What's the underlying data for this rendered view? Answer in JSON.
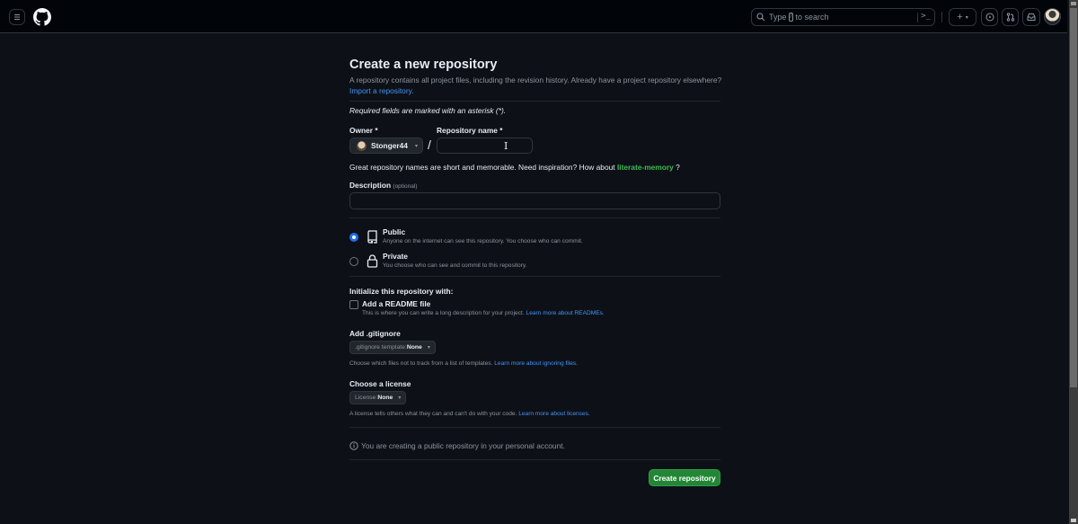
{
  "header": {
    "search_placeholder_pre": "Type",
    "search_key": "/",
    "search_placeholder_post": "to search",
    "command_palette_glyph": ">_",
    "create_new_glyph": "+"
  },
  "page": {
    "title": "Create a new repository",
    "subtitle": "A repository contains all project files, including the revision history. Already have a project repository elsewhere?",
    "import_link": "Import a repository.",
    "required_note": "Required fields are marked with an asterisk (*).",
    "owner_label": "Owner *",
    "owner_value": "Stonger44",
    "separator": "/",
    "repo_name_label": "Repository name *",
    "repo_name_value": "",
    "name_hint_pre": "Great repository names are short and memorable. Need inspiration? How about",
    "name_suggestion": "literate-memory",
    "name_hint_post": "?",
    "description_label": "Description",
    "description_optional": "(optional)",
    "description_value": "",
    "visibility": [
      {
        "title": "Public",
        "desc": "Anyone on the internet can see this repository. You choose who can commit.",
        "checked": true,
        "icon": "repo-icon"
      },
      {
        "title": "Private",
        "desc": "You choose who can see and commit to this repository.",
        "checked": false,
        "icon": "lock-icon"
      }
    ],
    "init_label": "Initialize this repository with:",
    "readme_label": "Add a README file",
    "readme_checked": false,
    "readme_desc": "This is where you can write a long description for your project.",
    "readme_link": "Learn more about READMEs.",
    "gitignore_label": "Add .gitignore",
    "gitignore_prefix": ".gitignore template:",
    "gitignore_value": "None",
    "gitignore_desc": "Choose which files not to track from a list of templates.",
    "gitignore_link": "Learn more about ignoring files.",
    "license_label": "Choose a license",
    "license_prefix": "License:",
    "license_value": "None",
    "license_desc": "A license tells others what they can and can't do with your code.",
    "license_link": "Learn more about licenses.",
    "notice": "You are creating a public repository in your personal account.",
    "create_button": "Create repository"
  },
  "colors": {
    "accent_blue": "#4493f8",
    "success_green": "#238636",
    "suggestion_green": "#3fb950",
    "background": "#0d1117",
    "header_bg": "#010409"
  }
}
